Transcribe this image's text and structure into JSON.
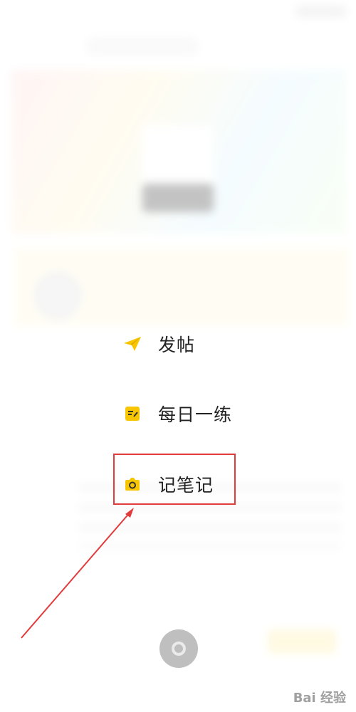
{
  "status": {
    "time": ""
  },
  "menu": {
    "items": [
      {
        "label": "发帖",
        "icon": "paper-plane-icon"
      },
      {
        "label": "每日一练",
        "icon": "practice-note-icon"
      },
      {
        "label": "记笔记",
        "icon": "note-camera-icon"
      }
    ]
  },
  "colors": {
    "accent": "#f7c600",
    "highlight": "#e23b3b"
  },
  "watermark": {
    "text": "Bai 经验"
  }
}
